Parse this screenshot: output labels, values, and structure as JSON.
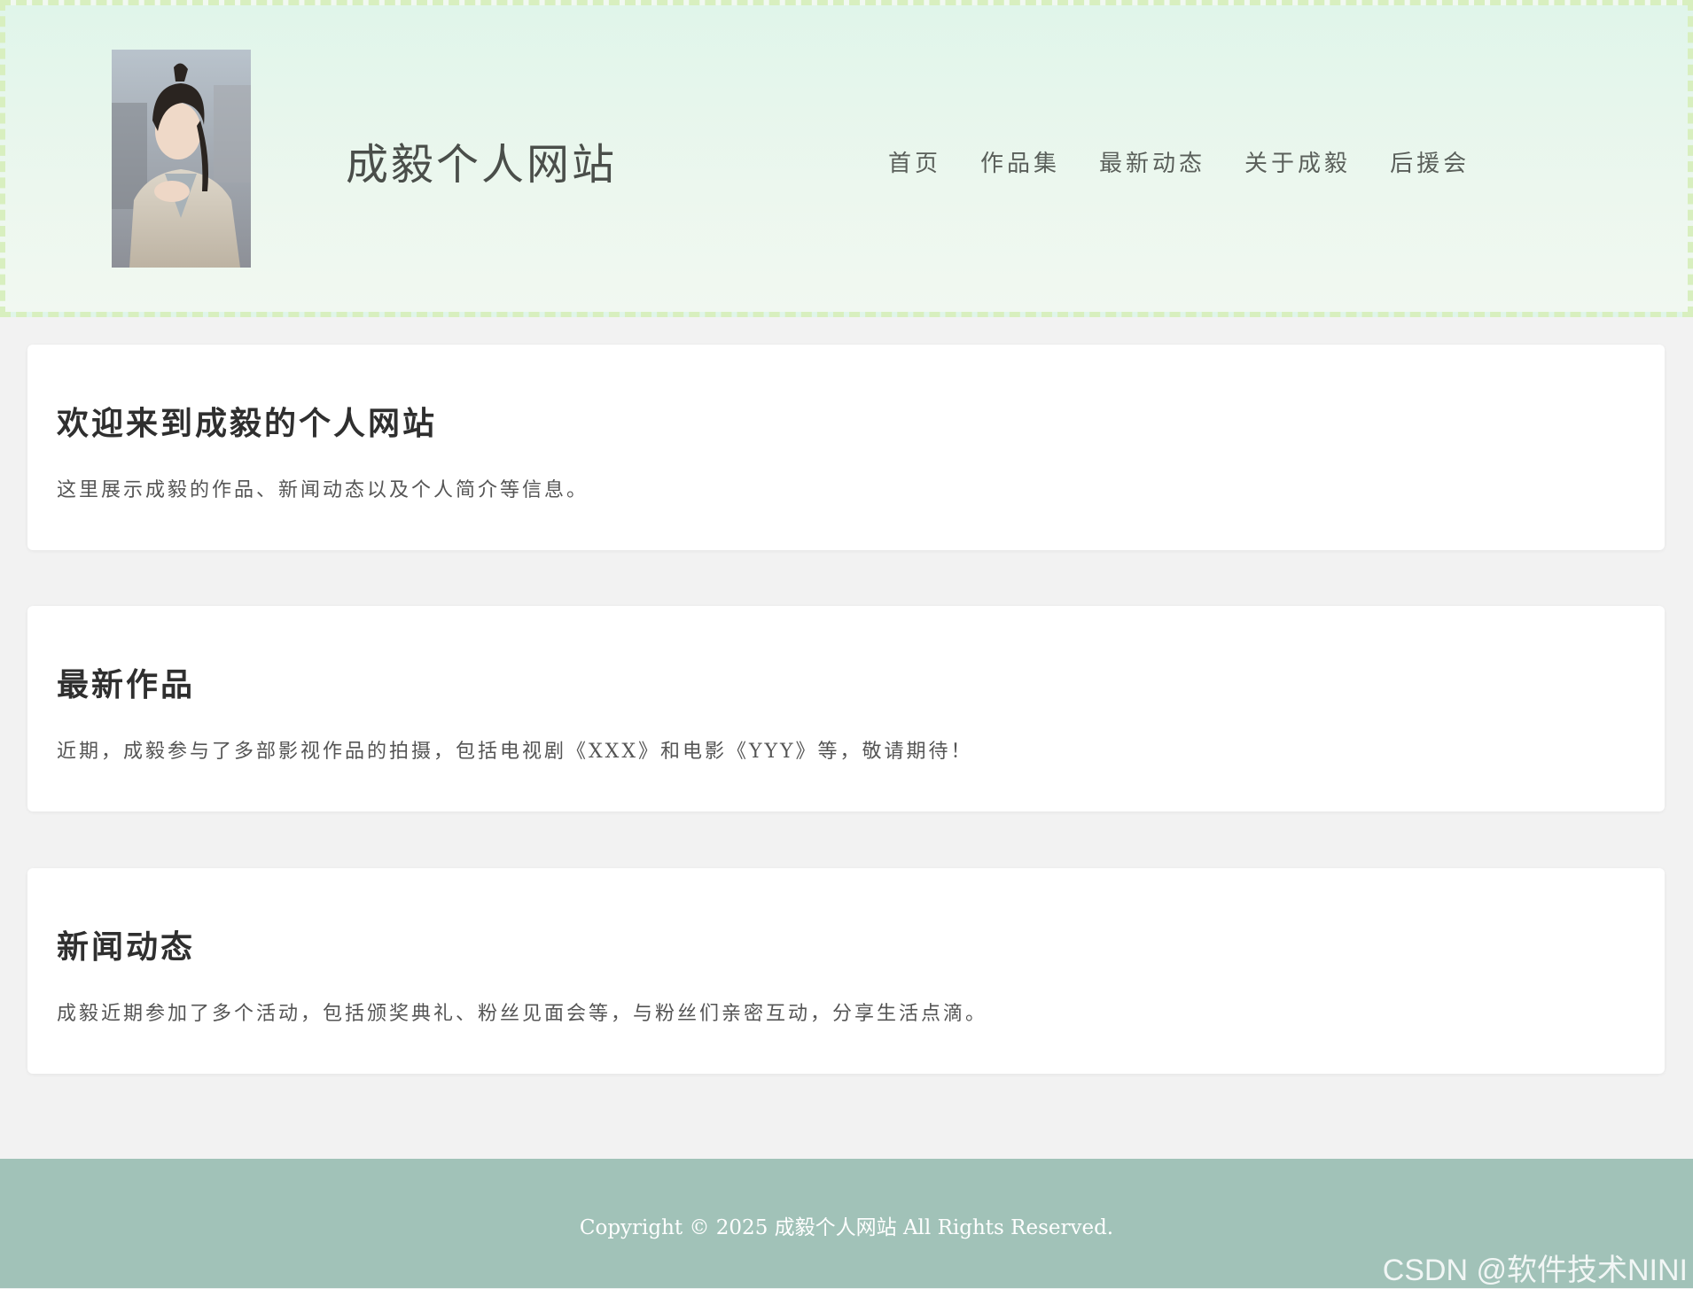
{
  "header": {
    "site_title": "成毅个人网站",
    "nav": [
      {
        "label": "首页"
      },
      {
        "label": "作品集"
      },
      {
        "label": "最新动态"
      },
      {
        "label": "关于成毅"
      },
      {
        "label": "后援会"
      }
    ]
  },
  "sections": [
    {
      "title": "欢迎来到成毅的个人网站",
      "text": "这里展示成毅的作品、新闻动态以及个人简介等信息。"
    },
    {
      "title": "最新作品",
      "text": "近期，成毅参与了多部影视作品的拍摄，包括电视剧《XXX》和电影《YYY》等，敬请期待！"
    },
    {
      "title": "新闻动态",
      "text": "成毅近期参加了多个活动，包括颁奖典礼、粉丝见面会等，与粉丝们亲密互动，分享生活点滴。"
    }
  ],
  "footer": {
    "copyright": "Copyright © 2025 成毅个人网站 All Rights Reserved.",
    "watermark": "CSDN @软件技术NINI"
  },
  "colors": {
    "header_bg": "#e0f5ea",
    "header_border": "#d8efbf",
    "page_bg": "#f2f2f2",
    "footer_bg": "#a1c2b8"
  }
}
